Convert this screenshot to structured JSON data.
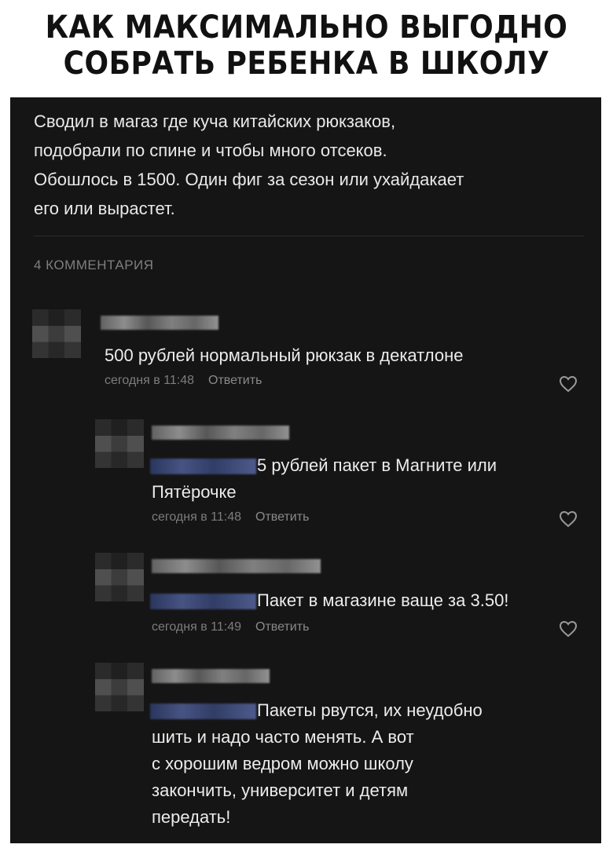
{
  "meme": {
    "title_line1": "КАК МАКСИМАЛЬНО ВЫГОДНО",
    "title_line2": "СОБРАТЬ РЕБЕНКА В ШКОЛУ"
  },
  "post": {
    "lines": [
      "Сводил в магаз где куча китайских рюкзаков,",
      "подобрали по спине и чтобы много отсеков.",
      "Обошлось в 1500. Один фиг за сезон или ухайдакает",
      "его или вырастет."
    ],
    "comments_count": "4 КОММЕНТАРИЯ"
  },
  "reply_label": "Ответить",
  "comments": [
    {
      "lines": [
        "500 рублей нормальный рюкзак в декатлоне"
      ],
      "time": "сегодня в 11:48"
    },
    {
      "lines": [
        "5 рублей пакет в Магните или",
        "Пятёрочке"
      ],
      "time": "сегодня в 11:48"
    },
    {
      "lines": [
        "Пакет в магазине ваще за 3.50!"
      ],
      "time": "сегодня в 11:49"
    },
    {
      "lines": [
        "Пакеты рвутся, их неудобно",
        "шить и надо часто менять. А вот",
        "с хорошим ведром можно школу",
        "закончить, университет и детям",
        "передать!"
      ]
    }
  ],
  "icons": {
    "like": "heart-icon"
  },
  "colors": {
    "background": "#151515",
    "text": "#ececec",
    "meta": "#7d7d7d"
  }
}
